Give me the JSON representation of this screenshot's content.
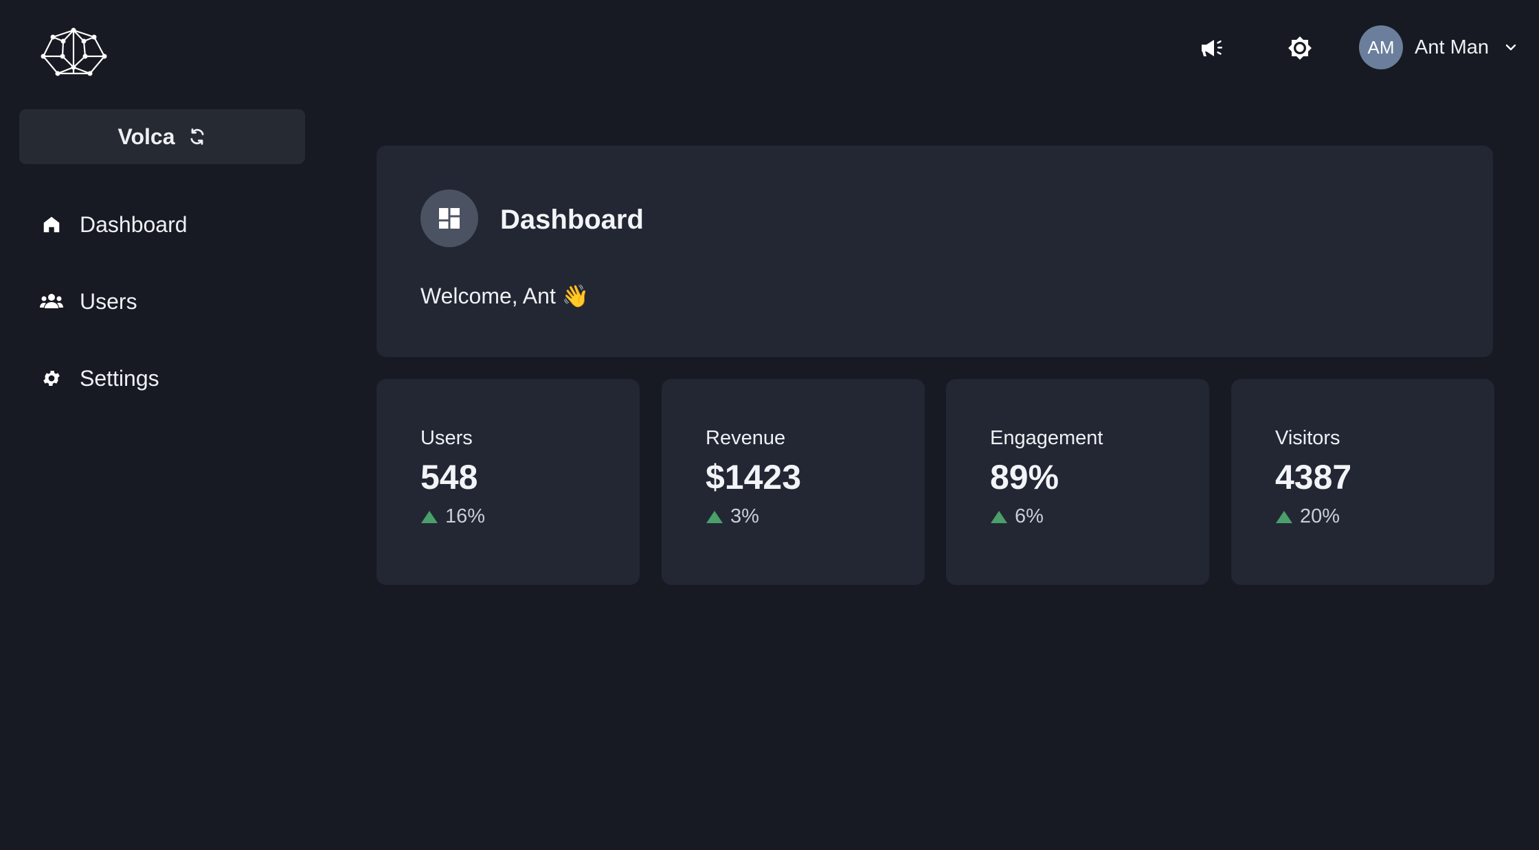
{
  "sidebar": {
    "logo_icon": "web-logo-icon",
    "workspace": {
      "name": "Volca",
      "icon": "sync-icon"
    },
    "items": [
      {
        "label": "Dashboard",
        "icon": "home-icon"
      },
      {
        "label": "Users",
        "icon": "users-icon"
      },
      {
        "label": "Settings",
        "icon": "gear-icon"
      }
    ]
  },
  "header": {
    "icons": [
      "megaphone-icon",
      "brightness-icon"
    ],
    "user": {
      "initials": "AM",
      "name": "Ant Man",
      "menu_icon": "chevron-down-icon"
    }
  },
  "main": {
    "title": "Dashboard",
    "title_icon": "dashboard-icon",
    "welcome": "Welcome, Ant 👋",
    "stats": [
      {
        "label": "Users",
        "value": "548",
        "change": "16%"
      },
      {
        "label": "Revenue",
        "value": "$1423",
        "change": "3%"
      },
      {
        "label": "Engagement",
        "value": "89%",
        "change": "6%"
      },
      {
        "label": "Visitors",
        "value": "4387",
        "change": "20%"
      }
    ]
  },
  "colors": {
    "background": "#171a23",
    "card": "#222733",
    "workspace_button": "#262a33",
    "avatar": "#6b7f9c",
    "trend_up": "#4a9f6a"
  }
}
